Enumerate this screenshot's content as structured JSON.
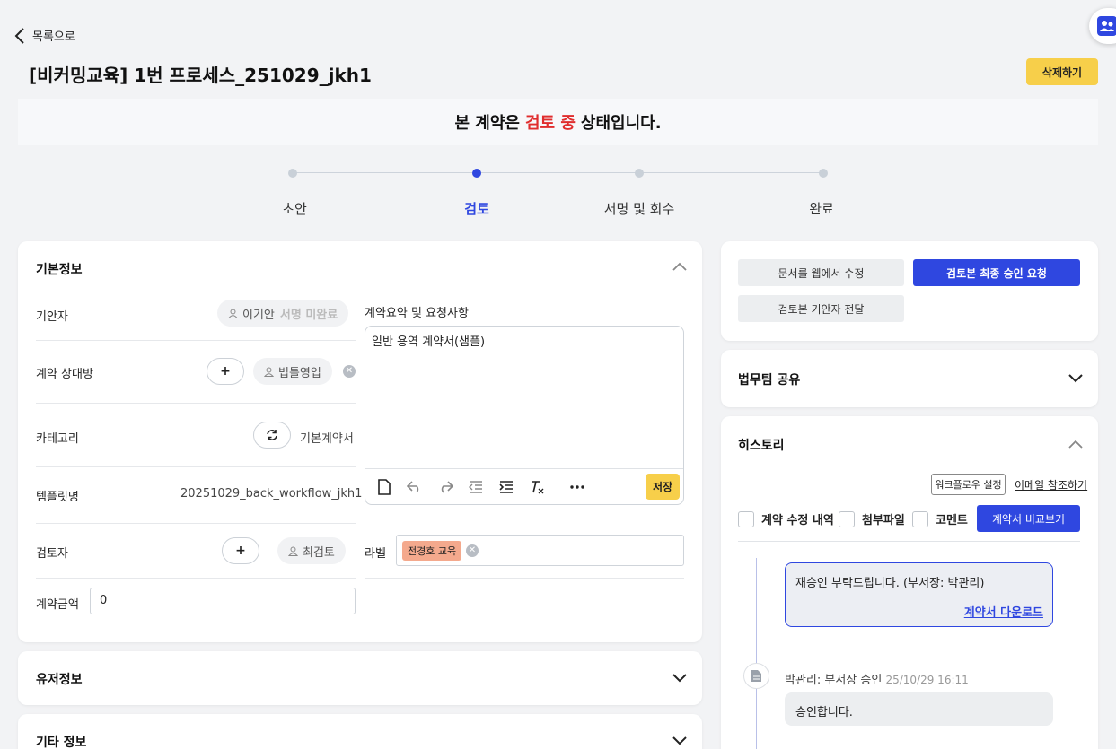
{
  "nav": {
    "back_label": "목록으로"
  },
  "page": {
    "title": "[비커밍교육] 1번 프로세스_251029_jkh1",
    "delete_label": "삭제하기"
  },
  "status_banner": {
    "prefix": "본 계약은",
    "status": "검토 중",
    "suffix": "상태입니다.",
    "status_color": "#e02d2d"
  },
  "steps": [
    {
      "label": "초안",
      "active": false
    },
    {
      "label": "검토",
      "active": true
    },
    {
      "label": "서명 및 회수",
      "active": false
    },
    {
      "label": "완료",
      "active": false
    }
  ],
  "basic_info": {
    "title": "기본정보",
    "drafter": {
      "label": "기안자",
      "name": "이기안",
      "sign_status": "서명 미완료"
    },
    "counterparty": {
      "label": "계약 상대방",
      "add_label": "+",
      "name": "법틀영업"
    },
    "category": {
      "label": "카테고리",
      "value": "기본계약서"
    },
    "template": {
      "label": "템플릿명",
      "value": "20251029_back_workflow_jkh1"
    },
    "reviewer": {
      "label": "검토자",
      "add_label": "+",
      "name": "최검토"
    },
    "amount": {
      "label": "계약금액",
      "value": "0"
    },
    "summary": {
      "label": "계약요약 및 요청사항",
      "content": "일반 용역 계약서(샘플)",
      "save_label": "저장"
    },
    "tag_field": {
      "label": "라벨",
      "tags": [
        "전경호 교육"
      ]
    }
  },
  "sections": {
    "user_info": "유저정보",
    "other_info": "기타 정보"
  },
  "actions": {
    "edit_web": "문서를 웹에서 수정",
    "final_approval": "검토본 최종 승인 요청",
    "send_drafter": "검토본 기안자 전달"
  },
  "legal_share": {
    "title": "법무팀 공유"
  },
  "history": {
    "title": "히스토리",
    "workflow_settings": "워크플로우 설정",
    "email_reference": "이메일 참조하기",
    "filters": [
      "계약 수정 내역",
      "첨부파일",
      "코멘트"
    ],
    "compare_label": "계약서 비교보기",
    "entries": [
      {
        "message": "재승인 부탁드립니다. (부서장: 박관리)",
        "link": "계약서 다운로드"
      },
      {
        "author": "박관리: 부서장 승인",
        "time": "25/10/29 16:11",
        "message": "승인합니다."
      }
    ]
  },
  "colors": {
    "accent": "#2f47e0",
    "yellow": "#f7cf4a",
    "tag": "#f4a98d"
  },
  "icons": [
    "chevron-left-icon",
    "chevron-up-icon",
    "chevron-down-icon",
    "user-icon",
    "refresh-icon",
    "document-icon",
    "undo-icon",
    "redo-icon",
    "outdent-icon",
    "indent-icon",
    "clear-format-icon",
    "more-icon",
    "close-icon",
    "people-icon"
  ]
}
